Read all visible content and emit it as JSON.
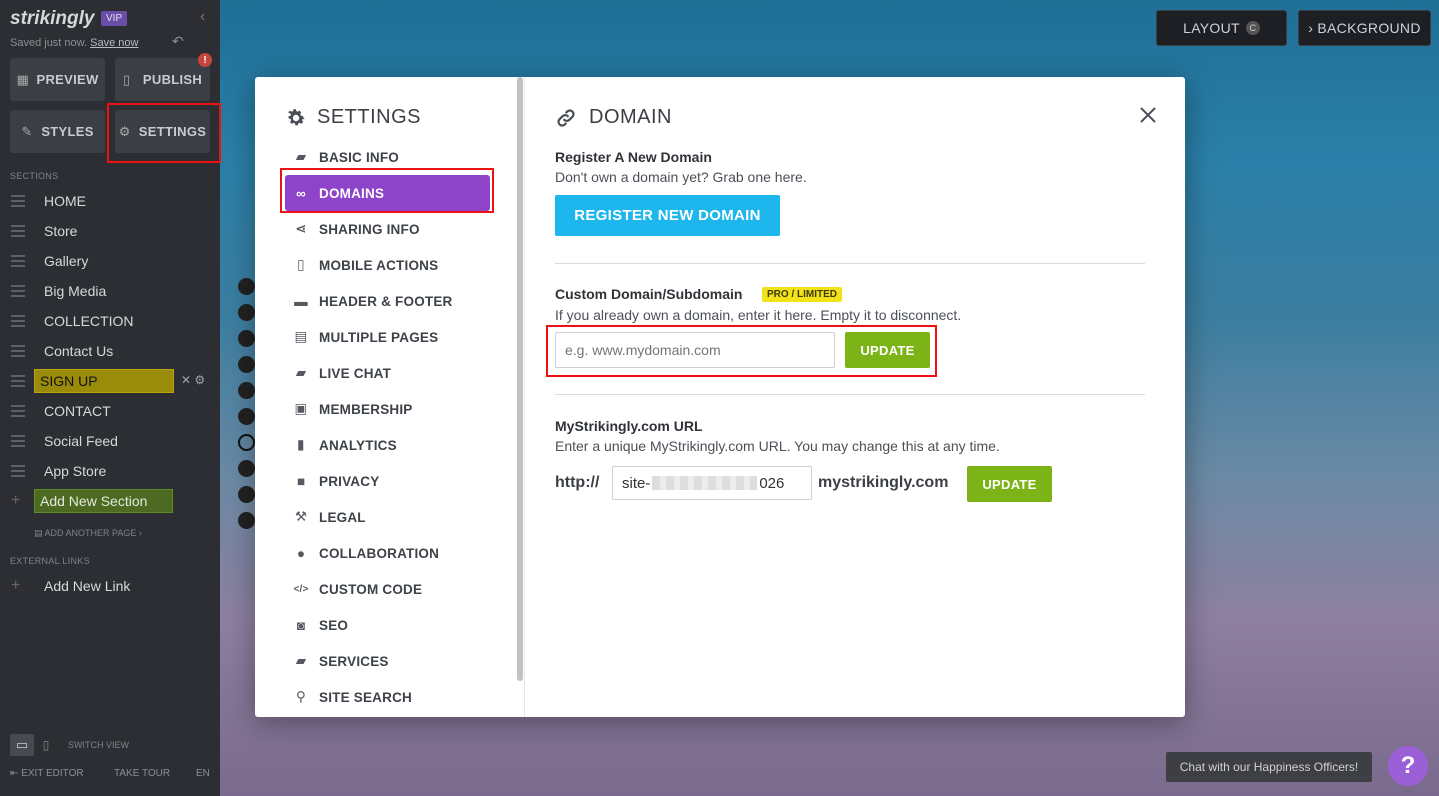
{
  "brand": {
    "logo": "strikingly",
    "vip_badge": "VIP"
  },
  "sidebar": {
    "saved_text": "Saved just now.",
    "save_now_link": "Save now",
    "preview_label": "PREVIEW",
    "publish_label": "PUBLISH",
    "publish_alert": "!",
    "styles_label": "STYLES",
    "settings_label": "SETTINGS",
    "sections_heading": "SECTIONS",
    "sections": [
      {
        "label": "HOME"
      },
      {
        "label": "Store"
      },
      {
        "label": "Gallery"
      },
      {
        "label": "Big Media"
      },
      {
        "label": "COLLECTION"
      },
      {
        "label": "Contact Us"
      },
      {
        "label": "SIGN UP"
      },
      {
        "label": "CONTACT"
      },
      {
        "label": "Social Feed"
      },
      {
        "label": "App Store"
      }
    ],
    "add_section_label": "Add New Section",
    "add_page_label": "ADD ANOTHER PAGE ›",
    "external_links_heading": "EXTERNAL LINKS",
    "add_link_label": "Add New Link",
    "switch_view_label": "SWITCH VIEW",
    "exit_editor_label": "EXIT EDITOR",
    "take_tour_label": "TAKE TOUR",
    "language_label": "EN"
  },
  "canvas": {
    "layout_label": "LAYOUT",
    "layout_badge": "C",
    "background_label": "› BACKGROUND"
  },
  "settings_modal": {
    "title": "SETTINGS",
    "menu": [
      {
        "label": "BASIC INFO",
        "icon": "briefcase-icon"
      },
      {
        "label": "DOMAINS",
        "icon": "link-icon",
        "active": true
      },
      {
        "label": "SHARING INFO",
        "icon": "share-icon"
      },
      {
        "label": "MOBILE ACTIONS",
        "icon": "mobile-icon"
      },
      {
        "label": "HEADER & FOOTER",
        "icon": "header-footer-icon"
      },
      {
        "label": "MULTIPLE PAGES",
        "icon": "pages-icon"
      },
      {
        "label": "LIVE CHAT",
        "icon": "chat-icon"
      },
      {
        "label": "MEMBERSHIP",
        "icon": "id-card-icon"
      },
      {
        "label": "ANALYTICS",
        "icon": "bar-chart-icon"
      },
      {
        "label": "PRIVACY",
        "icon": "lock-icon"
      },
      {
        "label": "LEGAL",
        "icon": "gavel-icon"
      },
      {
        "label": "COLLABORATION",
        "icon": "users-icon"
      },
      {
        "label": "CUSTOM CODE",
        "icon": "code-icon"
      },
      {
        "label": "SEO",
        "icon": "seo-search-icon"
      },
      {
        "label": "SERVICES",
        "icon": "folder-icon"
      },
      {
        "label": "SITE SEARCH",
        "icon": "search-icon"
      }
    ],
    "domain": {
      "title": "DOMAIN",
      "register_heading": "Register A New Domain",
      "register_text": "Don't own a domain yet? Grab one here.",
      "register_button": "REGISTER NEW DOMAIN",
      "custom_heading": "Custom Domain/Subdomain",
      "custom_badge": "PRO / LIMITED",
      "custom_text": "If you already own a domain, enter it here. Empty it to disconnect.",
      "custom_placeholder": "e.g. www.mydomain.com",
      "custom_update": "UPDATE",
      "my_heading": "MyStrikingly.com URL",
      "my_text": "Enter a unique MyStrikingly.com URL. You may change this at any time.",
      "my_prefix": "http://",
      "my_value_start": "site-",
      "my_value_end": "026",
      "my_suffix": "mystrikingly.com",
      "my_update": "UPDATE"
    }
  },
  "chat": {
    "label": "Chat with our Happiness Officers!",
    "help_icon": "?"
  },
  "colors": {
    "accent_purple": "#8e44c9",
    "register_blue": "#1db6ed",
    "update_green": "#7cb418",
    "highlight_red": "#e11111"
  }
}
